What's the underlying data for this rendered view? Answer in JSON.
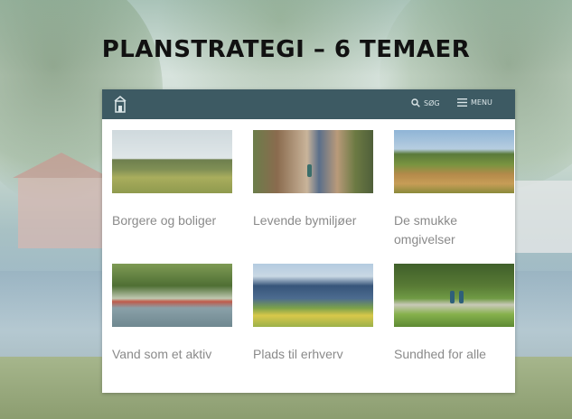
{
  "slide": {
    "title": "PLANSTRATEGI – 6 TEMAER"
  },
  "site": {
    "header": {
      "logo_icon": "building-logo-icon",
      "search_label": "SØG",
      "menu_label": "MENU"
    },
    "themes": [
      {
        "label": "Borgere og boliger",
        "image": "town-field-photo"
      },
      {
        "label": "Levende bymiljøer",
        "image": "street-shops-photo"
      },
      {
        "label": "De smukke omgivelser",
        "image": "countryside-photo"
      },
      {
        "label": "Vand som et aktiv",
        "image": "lake-boats-photo"
      },
      {
        "label": "Plads til erhverv",
        "image": "business-building-photo"
      },
      {
        "label": "Sundhed for alle",
        "image": "park-path-photo"
      }
    ]
  },
  "colors": {
    "header_bg": "#3d5a63",
    "label_text": "#8a8a8a",
    "title_text": "#111111"
  }
}
